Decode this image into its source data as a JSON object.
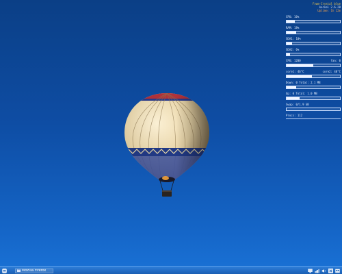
{
  "monitor": {
    "header_line1": "Fvwm-Crystal  blue",
    "header_line2": "kernel 2.6.28",
    "header_line3": "Uptime: 1h 12m",
    "rows": [
      {
        "label": "CPU: 16%",
        "level": 0.16
      },
      {
        "label": "RAM: 18%",
        "level": 0.18
      },
      {
        "label": "SDA1: 10%",
        "level": 0.1
      },
      {
        "label": "SDA2: 6%",
        "level": 0.06
      },
      {
        "label_left": "CPU: 1200",
        "label_right": "fan: 0",
        "level": 0.5
      },
      {
        "label_left": "core1: 46°C",
        "label_right": "core2: 48°C",
        "level": 0.48
      },
      {
        "label": "Down: 0  Total: 2.1 MB",
        "level": 0.18
      },
      {
        "label": "Up: 0  Total: 1.0 MB",
        "level": 0.24
      },
      {
        "label": "Swap: 0/1.9 GB",
        "level": 0.0
      },
      {
        "label": "Procs: 112",
        "level": 0.0
      }
    ]
  },
  "taskbar": {
    "window_title": "Mozilla Firefox",
    "colors": {
      "bar_top": "#2c7bd6",
      "bar_bottom": "#1a5fb3"
    }
  },
  "icons": {
    "start": "menu-icon",
    "task": "window-icon",
    "tray": [
      "monitor-icon",
      "network-icon",
      "volume-icon",
      "close-icon",
      "desktop-icon"
    ]
  },
  "colors": {
    "sky_top": "#0b3f86",
    "sky_bottom": "#1a72d6",
    "balloon_main": "#efe3c2",
    "balloon_band": "#1b2f7a",
    "balloon_stripe": "#c0392b"
  }
}
